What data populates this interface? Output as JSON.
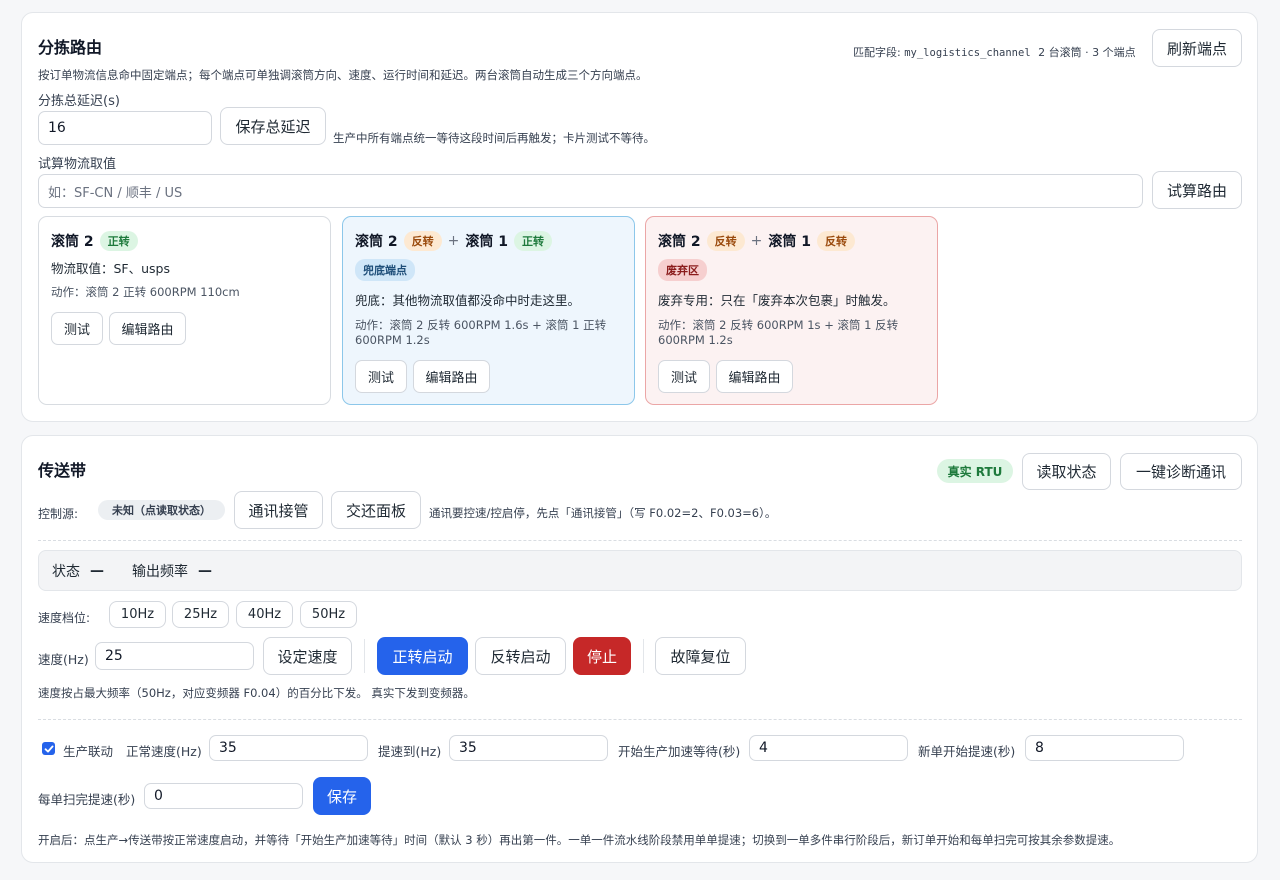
{
  "routing": {
    "title": "分拣路由",
    "match_field_label": "匹配字段:",
    "match_field_value": "my_logistics_channel",
    "match_summary": "2 台滚筒 · 3 个端点",
    "refresh_button": "刷新端点",
    "description": "按订单物流信息命中固定端点；每个端点可单独调滚筒方向、速度、运行时间和延迟。两台滚筒自动生成三个方向端点。",
    "delay_label": "分拣总延迟(s)",
    "delay_value": "16",
    "save_delay_button": "保存总延迟",
    "delay_hint": "生产中所有端点统一等待这段时间后再触发；卡片测试不等待。",
    "trial_label": "试算物流取值",
    "trial_placeholder": "如：SF-CN / 顺丰 / US",
    "trial_button": "试算路由",
    "cards": [
      {
        "drum_a": "滚筒 2",
        "dir_a": "正转",
        "value_text": "物流取值：SF、usps",
        "action_text": "动作：滚筒 2 正转 600RPM 110cm",
        "test_button": "测试",
        "edit_button": "编辑路由"
      },
      {
        "drum_a": "滚筒 2",
        "dir_a": "反转",
        "plus": "+",
        "drum_b": "滚筒 1",
        "dir_b": "正转",
        "badge": "兜底端点",
        "value_text": "兜底：其他物流取值都没命中时走这里。",
        "action_text": "动作：滚筒 2 反转 600RPM 1.6s + 滚筒 1 正转 600RPM 1.2s",
        "test_button": "测试",
        "edit_button": "编辑路由"
      },
      {
        "drum_a": "滚筒 2",
        "dir_a": "反转",
        "plus": "+",
        "drum_b": "滚筒 1",
        "dir_b": "反转",
        "badge": "废弃区",
        "value_text": "废弃专用：只在「废弃本次包裹」时触发。",
        "action_text": "动作：滚筒 2 反转 600RPM 1s + 滚筒 1 反转 600RPM 1.2s",
        "test_button": "测试",
        "edit_button": "编辑路由"
      }
    ]
  },
  "conveyor": {
    "title": "传送带",
    "rtu_badge": "真实 RTU",
    "read_status_button": "读取状态",
    "diagnose_button": "一键诊断通讯",
    "control_source_label": "控制源:",
    "control_source_value": "未知（点读取状态）",
    "comm_takeover_button": "通讯接管",
    "return_panel_button": "交还面板",
    "control_hint": "通讯要控速/控启停，先点「通讯接管」（写 F0.02=2、F0.03=6）。",
    "status_label": "状态",
    "status_value": "—",
    "freq_label": "输出频率",
    "freq_value": "—",
    "speed_steps_label": "速度档位:",
    "speed_steps": [
      "10Hz",
      "25Hz",
      "40Hz",
      "50Hz"
    ],
    "speed_label": "速度(Hz)",
    "speed_value": "25",
    "set_speed_button": "设定速度",
    "forward_button": "正转启动",
    "reverse_button": "反转启动",
    "stop_button": "停止",
    "reset_button": "故障复位",
    "speed_hint": "速度按占最大频率（50Hz，对应变频器 F0.04）的百分比下发。 真实下发到变频器。",
    "production_link_label": "生产联动",
    "production_link_checked": true,
    "normal_speed_label": "正常速度(Hz)",
    "normal_speed_value": "35",
    "boost_to_label": "提速到(Hz)",
    "boost_to_value": "35",
    "accel_wait_label": "开始生产加速等待(秒)",
    "accel_wait_value": "4",
    "new_order_boost_label": "新单开始提速(秒)",
    "new_order_boost_value": "8",
    "scan_done_boost_label": "每单扫完提速(秒)",
    "scan_done_boost_value": "0",
    "save_button": "保存",
    "footer_hint": "开启后：点生产→传送带按正常速度启动，并等待「开始生产加速等待」时间（默认 3 秒）再出第一件。一单一件流水线阶段禁用单单提速；切换到一单多件串行阶段后，新订单开始和每单扫完可按其余参数提速。"
  },
  "colors": {
    "primary": "#2563eb",
    "danger": "#c62828",
    "green_tag": "#dcf5e3",
    "orange_tag": "#fde9d2"
  },
  "icons": {
    "checkbox": "checkmark-icon"
  }
}
